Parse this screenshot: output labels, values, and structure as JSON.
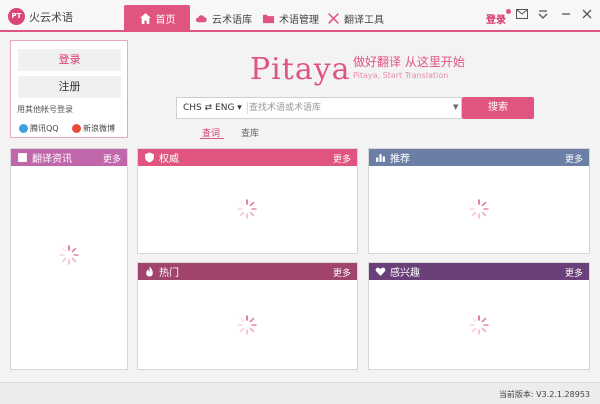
{
  "app": {
    "badge": "PT",
    "name": "火云术语"
  },
  "nav": {
    "home": "首页",
    "cloud": "云术语库",
    "term_manage": "术语管理",
    "tools": "翻译工具"
  },
  "titlebar": {
    "login": "登录"
  },
  "login_panel": {
    "login_btn": "登录",
    "register_btn": "注册",
    "other_login": "用其他帐号登录",
    "qq": "腾讯QQ",
    "weibo": "新浪微博"
  },
  "brand": {
    "logo": "Pitaya",
    "slogan": "做好翻译 从这里开始",
    "subslogan": "Pitaya, Start Translation"
  },
  "search": {
    "lang_pair": "CHS ⇄ ENG ▾",
    "placeholder": "查找术语或术语库",
    "button": "搜索"
  },
  "modes": {
    "word": "查词",
    "corpus": "查库"
  },
  "panels": {
    "news": {
      "title": "翻译资讯",
      "more": "更多"
    },
    "authority": {
      "title": "权威",
      "more": "更多"
    },
    "recommend": {
      "title": "推荐",
      "more": "更多"
    },
    "hot": {
      "title": "热门",
      "more": "更多"
    },
    "interest": {
      "title": "感兴趣",
      "more": "更多"
    }
  },
  "status": {
    "version": "当前版本: V3.2.1.28953"
  },
  "colors": {
    "accent": "#e0557f",
    "news": "#c066aa",
    "recommend": "#6b7fa6",
    "hot": "#a0436d",
    "interest": "#6a3f7a"
  }
}
